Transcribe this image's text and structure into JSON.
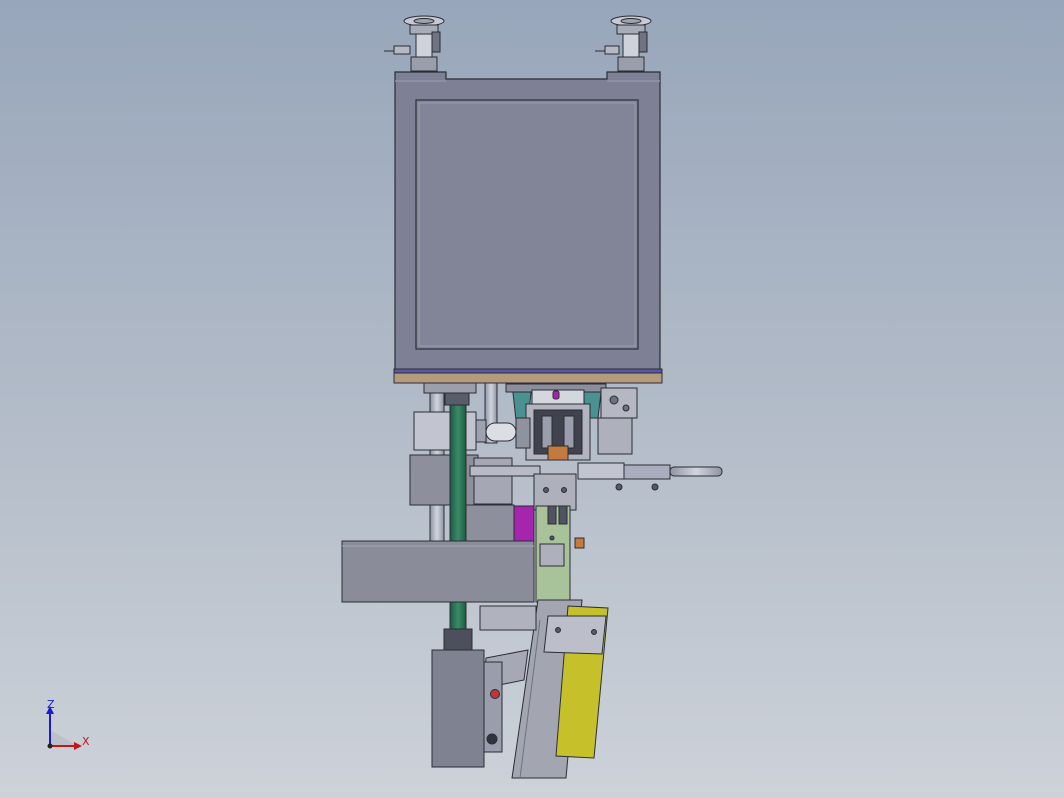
{
  "viewport": {
    "background_top": "#98a6bb",
    "background_bottom": "#cdd2d9"
  },
  "model": {
    "colors": {
      "housing": "#7e8196",
      "housing_panel": "#828598",
      "outline": "#2b2d35",
      "base_plate": "#b59b7e",
      "base_strip": "#5c55a0",
      "green_column": "#2e7558",
      "teal": "#4a9191",
      "magenta": "#a625ad",
      "yellow": "#c6c12a",
      "light_green": "#a8c29a",
      "copper": "#c47a3c",
      "rail": "#a9aebf",
      "block_gray": "#8d909c"
    }
  },
  "triad": {
    "z_label": "Z",
    "x_label": "X",
    "z_color": "#1a1ad0",
    "x_color": "#c01818"
  }
}
